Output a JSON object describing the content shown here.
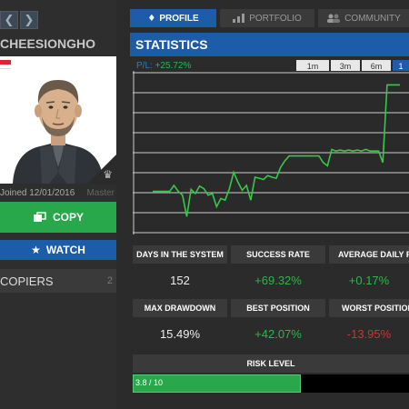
{
  "profile": {
    "username": "CHEESIONGHO",
    "joined": "Joined 12/01/2016",
    "level": "Master",
    "copy_label": "COPY",
    "watch_label": "WATCH",
    "copiers_label": "COPIERS",
    "copiers_count": "2"
  },
  "nav": {
    "prev": "❮",
    "next": "❯"
  },
  "tabs": [
    {
      "label": "PROFILE",
      "icon": "tie-icon"
    },
    {
      "label": "PORTFOLIO",
      "icon": "bar-chart-icon"
    },
    {
      "label": "COMMUNITY",
      "icon": "users-icon"
    }
  ],
  "statistics": {
    "title": "STATISTICS",
    "pl_label": "P/L:",
    "pl_value": "+25.72%",
    "ranges": [
      "1m",
      "3m",
      "6m",
      "1"
    ],
    "active_range": "1"
  },
  "stats": {
    "days_label": "DAYS IN THE SYSTEM",
    "days_value": "152",
    "success_label": "SUCCESS RATE",
    "success_value": "+69.32%",
    "avg_label": "AVERAGE DAILY PA",
    "avg_value": "+0.17%",
    "drawdown_label": "MAX DRAWDOWN",
    "drawdown_value": "15.49%",
    "best_label": "BEST POSITION",
    "best_value": "+42.07%",
    "worst_label": "WORST POSITION",
    "worst_value": "-13.95%"
  },
  "risk": {
    "label": "RISK LEVEL",
    "value_text": "3.8 / 10",
    "fraction": 0.38
  },
  "colors": {
    "accent": "#1d5ca8",
    "positive": "#28a84a",
    "negative": "#cc3333",
    "chart_line": "#35c84a"
  },
  "chart_data": {
    "type": "line",
    "x": [
      0,
      1,
      2,
      3,
      4,
      5,
      6,
      7,
      8,
      9,
      10,
      11,
      12,
      13,
      14,
      15,
      16,
      17,
      18,
      19,
      20,
      21,
      22,
      23,
      24,
      25,
      26,
      27,
      28,
      29,
      30,
      31,
      32,
      33,
      34,
      35,
      36,
      37,
      38,
      39,
      40,
      41,
      42,
      43,
      44,
      45,
      46,
      47,
      48,
      49,
      50,
      51,
      52,
      53,
      54,
      55,
      56,
      57,
      58
    ],
    "y": [
      -6.8,
      -6.8,
      -6.8,
      -6.8,
      -6.8,
      -5.0,
      -6.8,
      -8.0,
      -14.5,
      -6.2,
      -7.5,
      -5.2,
      -6.0,
      -8.0,
      -7.5,
      -11.5,
      -9.0,
      -9.5,
      -6.0,
      -1.0,
      -4.0,
      -6.5,
      -5.0,
      -9.5,
      -2.5,
      -2.8,
      -3.2,
      -2.0,
      -2.5,
      -2.8,
      0.5,
      2.5,
      4.0,
      4.0,
      4.0,
      4.0,
      4.0,
      4.0,
      4.0,
      4.0,
      2.0,
      1.0,
      6.0,
      5.5,
      5.8,
      5.5,
      5.8,
      5.5,
      5.8,
      5.5,
      6.0,
      5.5,
      5.5,
      5.5,
      2.0,
      25.72,
      25.72,
      25.72,
      25.72
    ],
    "ylim": [
      -20,
      30
    ],
    "grid": true
  }
}
